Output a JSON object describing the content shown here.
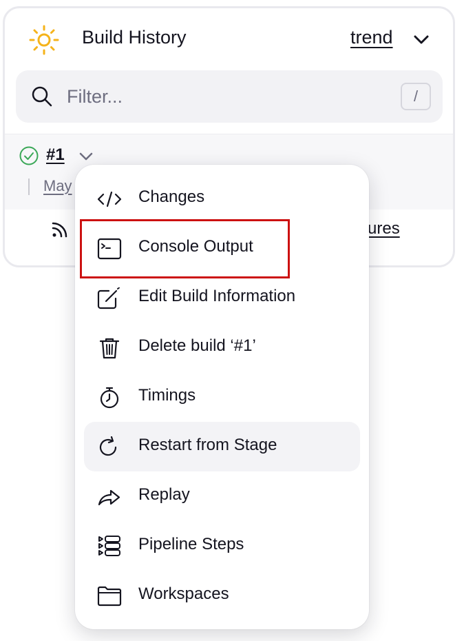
{
  "build_history": {
    "title": "Build History",
    "trend_label": "trend",
    "filter": {
      "placeholder": "Filter...",
      "shortcut": "/"
    },
    "builds": [
      {
        "number": "#1",
        "date": "May",
        "status": "success"
      }
    ],
    "footer": {
      "failures_link": "ailures"
    }
  },
  "context_menu": {
    "items": [
      {
        "label": "Changes",
        "icon": "code-icon"
      },
      {
        "label": "Console Output",
        "icon": "terminal-icon"
      },
      {
        "label": "Edit Build Information",
        "icon": "edit-icon"
      },
      {
        "label": "Delete build ‘#1’",
        "icon": "trash-icon"
      },
      {
        "label": "Timings",
        "icon": "stopwatch-icon"
      },
      {
        "label": "Restart from Stage",
        "icon": "restart-icon"
      },
      {
        "label": "Replay",
        "icon": "replay-icon"
      },
      {
        "label": "Pipeline Steps",
        "icon": "steps-icon"
      },
      {
        "label": "Workspaces",
        "icon": "folder-icon"
      }
    ],
    "hovered_item": "Restart from Stage",
    "highlighted_item": "Console Output"
  },
  "colors": {
    "sun": "#f5b31b",
    "success": "#3aa757",
    "highlight": "#cc1111",
    "hover_bg": "#f3f3f6"
  }
}
